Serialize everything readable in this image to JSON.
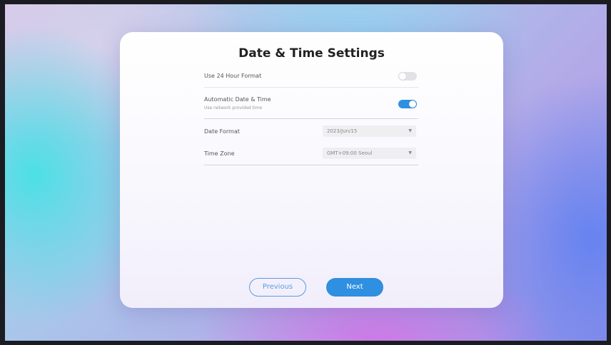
{
  "page": {
    "title": "Date & Time Settings"
  },
  "settings": {
    "use_24_hour": {
      "label": "Use 24 Hour Format",
      "enabled": false
    },
    "automatic_datetime": {
      "label": "Automatic Date & Time",
      "sublabel": "Use network provided time",
      "enabled": true
    },
    "date_format": {
      "label": "Date Format",
      "value": "2023/Jun/15"
    },
    "time_zone": {
      "label": "Time Zone",
      "value": "GMT+09:00 Seoul"
    }
  },
  "buttons": {
    "previous": "Previous",
    "next": "Next"
  },
  "icons": {
    "dropdown": "chevron-down-icon"
  },
  "colors": {
    "accent": "#2f8fe0",
    "toggle_off": "#e2e2e6"
  }
}
